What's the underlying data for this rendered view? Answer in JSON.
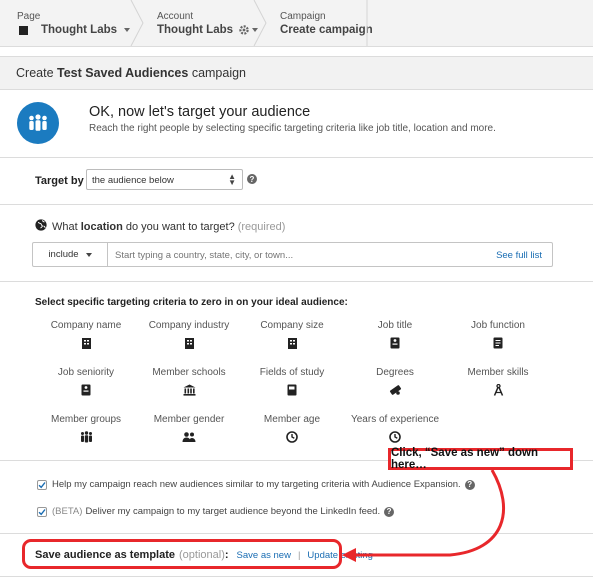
{
  "breadcrumb": {
    "page": {
      "label": "Page",
      "value": "Thought Labs"
    },
    "account": {
      "label": "Account",
      "value": "Thought Labs"
    },
    "campaign": {
      "label": "Campaign",
      "value": "Create campaign"
    }
  },
  "header": {
    "prefix": "Create",
    "name": "Test Saved Audiences",
    "suffix": "campaign"
  },
  "intro": {
    "title": "OK, now let's target your audience",
    "subtitle": "Reach the right people by selecting specific targeting criteria like job title, location and more."
  },
  "target_by": {
    "label": "Target by",
    "selected": "the audience below"
  },
  "location": {
    "q_prefix": "What",
    "q_bold": "location",
    "q_suffix": "do you want to target?",
    "required": "(required)",
    "include": "include",
    "placeholder": "Start typing a country, state, city, or town...",
    "see_full": "See full list"
  },
  "criteria": {
    "title": "Select specific targeting criteria to zero in on your ideal audience:",
    "items": [
      {
        "label": "Company name",
        "icon": "building-icon"
      },
      {
        "label": "Company industry",
        "icon": "building-icon"
      },
      {
        "label": "Company size",
        "icon": "building-icon"
      },
      {
        "label": "Job title",
        "icon": "badge-icon"
      },
      {
        "label": "Job function",
        "icon": "document-icon"
      },
      {
        "label": "Job seniority",
        "icon": "badge-icon"
      },
      {
        "label": "Member schools",
        "icon": "school-icon"
      },
      {
        "label": "Fields of study",
        "icon": "book-icon"
      },
      {
        "label": "Degrees",
        "icon": "diploma-icon"
      },
      {
        "label": "Member skills",
        "icon": "compass-icon"
      },
      {
        "label": "Member groups",
        "icon": "group-icon"
      },
      {
        "label": "Member gender",
        "icon": "people-icon"
      },
      {
        "label": "Member age",
        "icon": "clock-icon"
      },
      {
        "label": "Years of experience",
        "icon": "clock-icon"
      }
    ]
  },
  "checks": {
    "expansion": {
      "text": "Help my campaign reach new audiences similar to my targeting criteria with Audience Expansion.",
      "checked": true
    },
    "network": {
      "beta": "(BETA)",
      "text": "Deliver my campaign to my target audience beyond the LinkedIn feed.",
      "checked": true
    }
  },
  "save": {
    "label": "Save audience as template",
    "optional": "(optional)",
    "colon": ":",
    "save_new": "Save as new",
    "divider": "|",
    "update": "Update existing"
  },
  "annotation": {
    "callout": "Click, “Save as new” down here…",
    "color": "#e8272b"
  },
  "colors": {
    "accent": "#1b7bc0",
    "link": "#1a6db3"
  }
}
